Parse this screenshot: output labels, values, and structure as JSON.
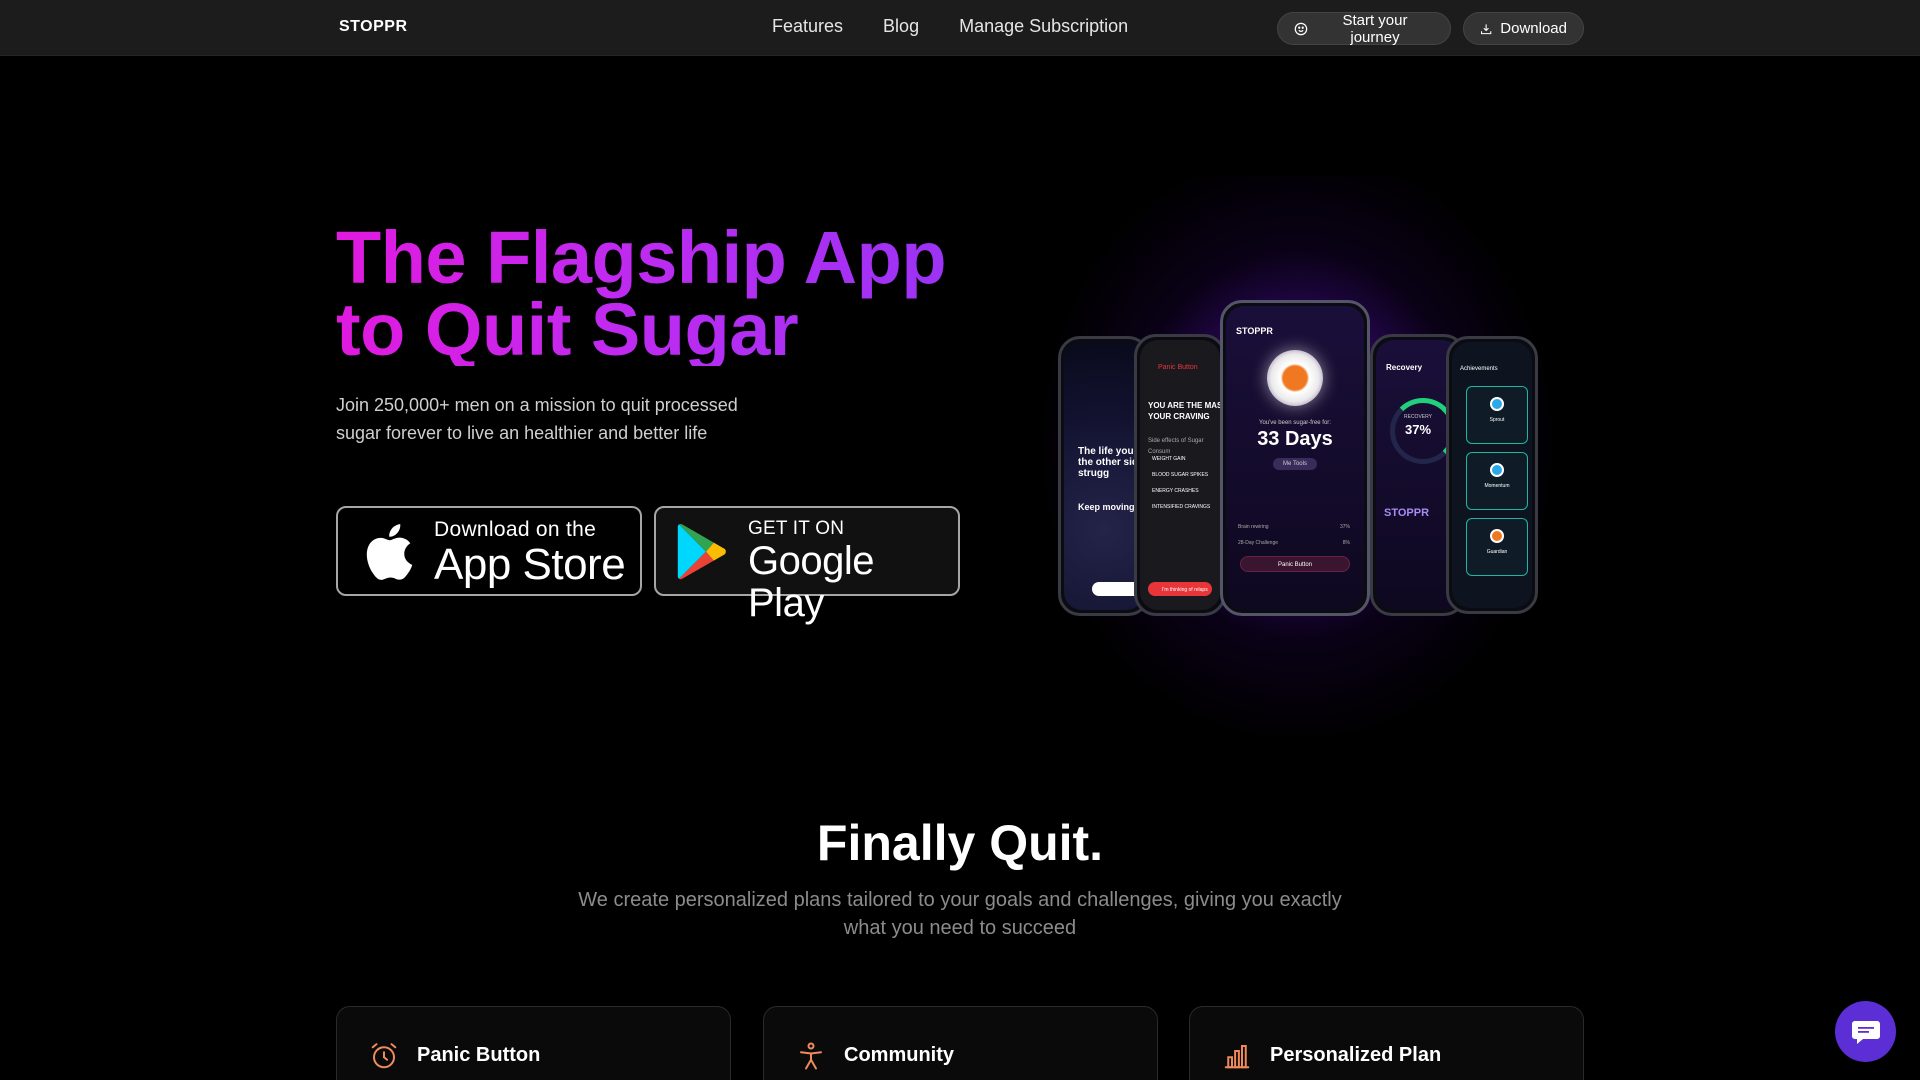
{
  "nav": {
    "brand": "STOPPR",
    "links": [
      "Features",
      "Blog",
      "Manage Subscription"
    ],
    "start_label": "Start your journey",
    "download_label": "Download"
  },
  "hero": {
    "title_line1": "The Flagship App",
    "title_line2": "to Quit Sugar",
    "subtitle": "Join 250,000+ men on a mission to quit processed sugar forever to live an healthier and better life",
    "app_store": {
      "small": "Download on the",
      "big": "App Store"
    },
    "google_play": {
      "small": "GET IT ON",
      "big": "Google Play"
    }
  },
  "phones": {
    "main_brand": "STOPPR",
    "main_caption": "You've been sugar-free for:",
    "main_days": "33 Days",
    "main_pill": "Me Tools",
    "main_panic": "Panic Button",
    "main_streak": "Brain rewiring",
    "main_streak_pct": "37%",
    "main_challenge": "28-Day Challenge",
    "main_challenge_pct": "8%",
    "p1_text": "The life you w the other sid strugg",
    "p1_cta": "Keep moving",
    "p2_header": "Panic Button",
    "p2_title": "YOU ARE THE MAST YOUR CRAVING",
    "p2_side": "Side effects of Sugar Consum",
    "p2_items": [
      "WEIGHT GAIN",
      "BLOOD SUGAR SPIKES",
      "ENERGY CRASHES",
      "INTENSIFIED CRAVINGS"
    ],
    "p2_btn": "I'm thinking of relaps",
    "p4_title": "Recovery",
    "p4_label": "RECOVERY",
    "p4_pct": "37%",
    "p4_brand": "STOPPR",
    "p5_title": "Achievements",
    "p5_items": [
      "Sprout",
      "Momentum",
      "Guardian"
    ]
  },
  "section": {
    "title": "Finally Quit.",
    "subtitle": "We create personalized plans tailored to your goals and challenges, giving you exactly what you need to succeed"
  },
  "features": [
    {
      "title": "Panic Button",
      "icon": "alarm-clock-icon"
    },
    {
      "title": "Community",
      "icon": "person-icon"
    },
    {
      "title": "Personalized Plan",
      "icon": "bar-chart-icon"
    }
  ],
  "colors": {
    "accent_pink": "#e11adf",
    "accent_purple": "#9b33f5",
    "icon_orange": "#f08a5d",
    "chat_purple": "#5b2ed6"
  }
}
